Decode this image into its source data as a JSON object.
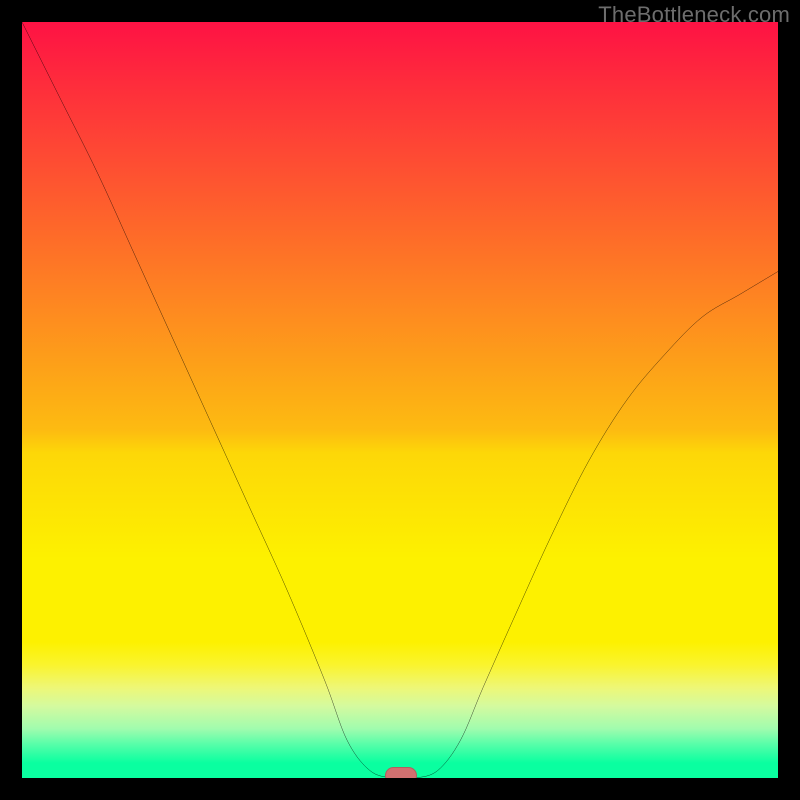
{
  "watermark": "TheBottleneck.com",
  "chart_data": {
    "type": "line",
    "title": "",
    "xlabel": "",
    "ylabel": "",
    "xlim": [
      0,
      100
    ],
    "ylim": [
      0,
      100
    ],
    "grid": false,
    "legend": false,
    "background_gradient": {
      "direction": "vertical",
      "stops": [
        {
          "pos": 0,
          "color": "#fe1244"
        },
        {
          "pos": 45,
          "color": "#fd9f19"
        },
        {
          "pos": 71,
          "color": "#fdf100"
        },
        {
          "pos": 100,
          "color": "#0affa0"
        }
      ]
    },
    "series": [
      {
        "name": "bottleneck-curve",
        "color": "#000000",
        "x": [
          0,
          5,
          10,
          15,
          20,
          25,
          30,
          35,
          40,
          43,
          46,
          49,
          52,
          55,
          58,
          61,
          65,
          70,
          75,
          80,
          85,
          90,
          95,
          100
        ],
        "values": [
          100,
          90,
          80,
          69,
          58,
          47,
          36,
          25,
          13,
          5,
          1,
          0,
          0,
          1,
          5,
          12,
          21,
          32,
          42,
          50,
          56,
          61,
          64,
          67
        ]
      }
    ],
    "marker": {
      "name": "optimal-point",
      "x": 50,
      "y": 0,
      "color": "#d17070"
    }
  }
}
